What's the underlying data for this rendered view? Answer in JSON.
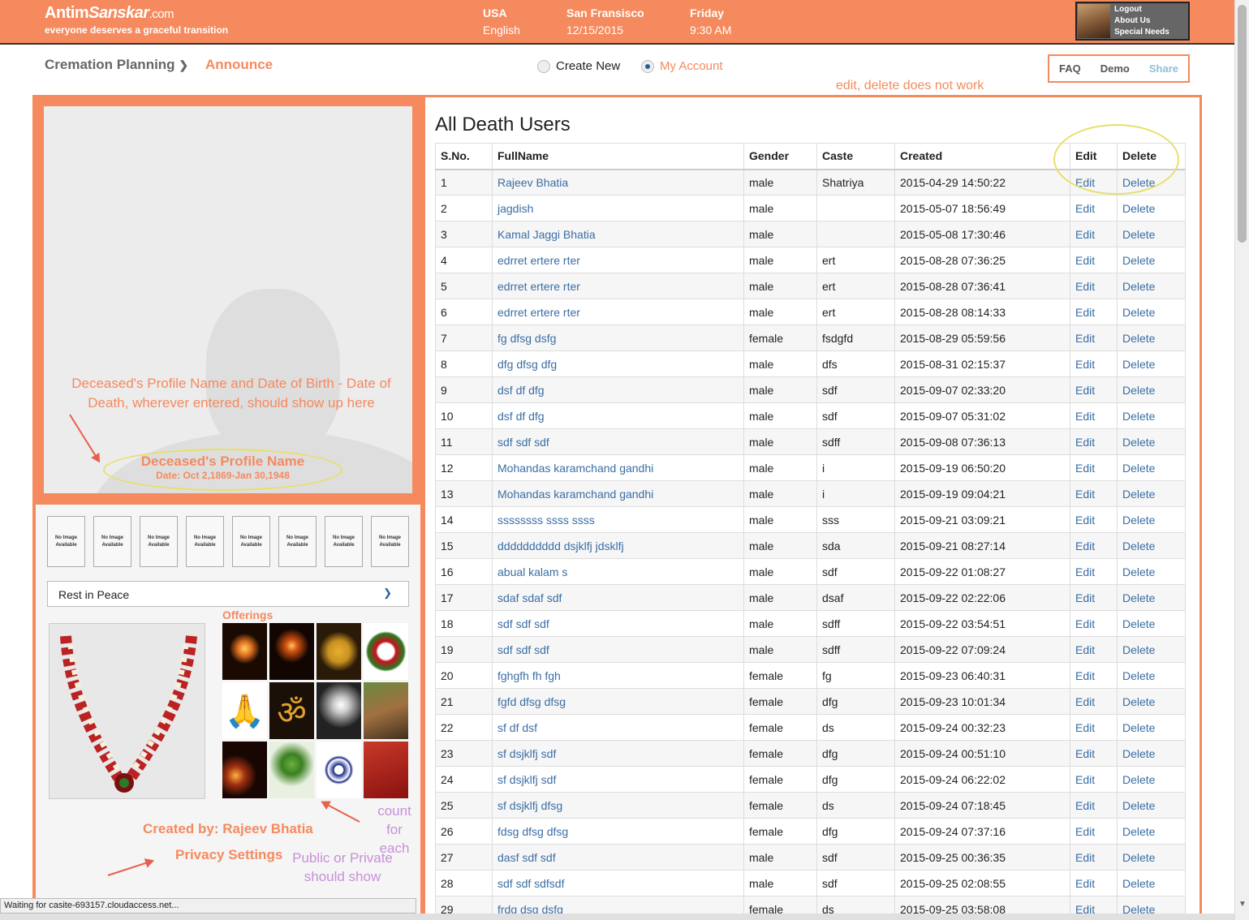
{
  "header": {
    "brand_main": "Antim",
    "brand_italic": "Sanskar",
    "brand_suffix": ".com",
    "tagline": "everyone deserves a graceful transition",
    "country": "USA",
    "language": "English",
    "city": "San Fransisco",
    "date": "12/15/2015",
    "day": "Friday",
    "time": "9:30 AM",
    "user_links": [
      "Logout",
      "About Us",
      "Special Needs"
    ]
  },
  "nav": {
    "cremation": "Cremation Planning",
    "chevron": "❯",
    "announce": "Announce",
    "radio_create": "Create New",
    "radio_account": "My Account",
    "faq": "FAQ",
    "demo": "Demo",
    "share": "Share"
  },
  "annotations": {
    "edit_delete": "edit, delete does not work",
    "profile_note": "Deceased's Profile Name and Date of Birth - Date of Death, wherever entered, should show up here",
    "count_note": "count for each",
    "privacy_note": "Public or Private should show"
  },
  "profile": {
    "name": "Deceased's Profile Name",
    "dates": "Date: Oct 2,1869-Jan 30,1948",
    "no_image": "No Image Available",
    "select": "Rest in Peace",
    "offerings_title": "Offerings",
    "created_by": "Created by: Rajeev Bhatia",
    "privacy": "Privacy Settings"
  },
  "table": {
    "title": "All Death Users",
    "columns": [
      "S.No.",
      "FullName",
      "Gender",
      "Caste",
      "Created",
      "Edit",
      "Delete"
    ],
    "rows": [
      [
        "1",
        "Rajeev Bhatia",
        "male",
        "Shatriya",
        "2015-04-29 14:50:22"
      ],
      [
        "2",
        "jagdish",
        "male",
        "",
        "2015-05-07 18:56:49"
      ],
      [
        "3",
        "Kamal Jaggi Bhatia",
        "male",
        "",
        "2015-05-08 17:30:46"
      ],
      [
        "4",
        "edrret ertere rter",
        "male",
        "ert",
        "2015-08-28 07:36:25"
      ],
      [
        "5",
        "edrret ertere rter",
        "male",
        "ert",
        "2015-08-28 07:36:41"
      ],
      [
        "6",
        "edrret ertere rter",
        "male",
        "ert",
        "2015-08-28 08:14:33"
      ],
      [
        "7",
        "fg dfsg dsfg",
        "female",
        "fsdgfd",
        "2015-08-29 05:59:56"
      ],
      [
        "8",
        "dfg dfsg dfg",
        "male",
        "dfs",
        "2015-08-31 02:15:37"
      ],
      [
        "9",
        "dsf df dfg",
        "male",
        "sdf",
        "2015-09-07 02:33:20"
      ],
      [
        "10",
        "dsf df dfg",
        "male",
        "sdf",
        "2015-09-07 05:31:02"
      ],
      [
        "11",
        "sdf sdf sdf",
        "male",
        "sdff",
        "2015-09-08 07:36:13"
      ],
      [
        "12",
        "Mohandas karamchand gandhi",
        "male",
        "i",
        "2015-09-19 06:50:20"
      ],
      [
        "13",
        "Mohandas karamchand gandhi",
        "male",
        "i",
        "2015-09-19 09:04:21"
      ],
      [
        "14",
        "ssssssss ssss ssss",
        "male",
        "sss",
        "2015-09-21 03:09:21"
      ],
      [
        "15",
        "dddddddddd dsjklfj jdsklfj",
        "male",
        "sda",
        "2015-09-21 08:27:14"
      ],
      [
        "16",
        "abual kalam s",
        "male",
        "sdf",
        "2015-09-22 01:08:27"
      ],
      [
        "17",
        "sdaf sdaf sdf",
        "male",
        "dsaf",
        "2015-09-22 02:22:06"
      ],
      [
        "18",
        "sdf sdf sdf",
        "male",
        "sdff",
        "2015-09-22 03:54:51"
      ],
      [
        "19",
        "sdf sdf sdf",
        "male",
        "sdff",
        "2015-09-22 07:09:24"
      ],
      [
        "20",
        "fghgfh fh fgh",
        "female",
        "fg",
        "2015-09-23 06:40:31"
      ],
      [
        "21",
        "fgfd dfsg dfsg",
        "female",
        "dfg",
        "2015-09-23 10:01:34"
      ],
      [
        "22",
        "sf df dsf",
        "female",
        "ds",
        "2015-09-24 00:32:23"
      ],
      [
        "23",
        "sf dsjklfj sdf",
        "female",
        "dfg",
        "2015-09-24 00:51:10"
      ],
      [
        "24",
        "sf dsjklfj sdf",
        "female",
        "dfg",
        "2015-09-24 06:22:02"
      ],
      [
        "25",
        "sf dsjklfj dfsg",
        "female",
        "ds",
        "2015-09-24 07:18:45"
      ],
      [
        "26",
        "fdsg dfsg dfsg",
        "female",
        "dfg",
        "2015-09-24 07:37:16"
      ],
      [
        "27",
        "dasf sdf sdf",
        "male",
        "sdf",
        "2015-09-25 00:36:35"
      ],
      [
        "28",
        "sdf sdf sdfsdf",
        "male",
        "sdf",
        "2015-09-25 02:08:55"
      ],
      [
        "29",
        "frdg dsg dsfg",
        "female",
        "ds",
        "2015-09-25 03:58:08"
      ]
    ],
    "edit_label": "Edit",
    "delete_label": "Delete"
  },
  "status": "Waiting for casite-693157.cloudaccess.net..."
}
